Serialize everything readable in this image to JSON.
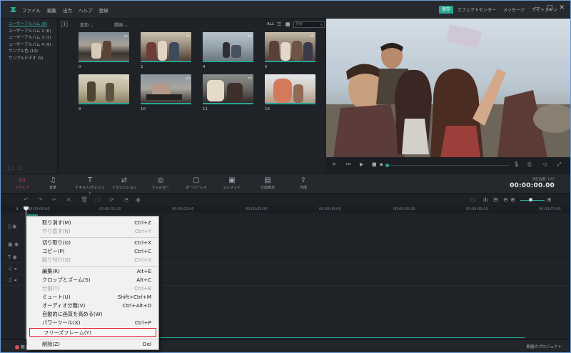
{
  "menubar": [
    "ファイル",
    "編集",
    "出力",
    "ヘルプ",
    "登録"
  ],
  "header": {
    "save": "保存",
    "right_menu": [
      "エフェクトセンター",
      "メッセージ",
      "ライトスキン"
    ],
    "window_controls": [
      "—",
      "□",
      "✕"
    ]
  },
  "sidebar": {
    "items": [
      "ユーザーアルバム (8)",
      "ユーザーアルバム 2 (6)",
      "ユーザーアルバム 3 (1)",
      "ユーザーアルバム 4 (9)",
      "サンプル色 (13)",
      "サンプルビデオ (9)"
    ]
  },
  "media": {
    "import_label": "追加 ⌄",
    "record_label": "録画 ⌄",
    "all_label": "ALL",
    "search_placeholder": "検索",
    "thumbs": [
      "0",
      "2",
      "4",
      "5",
      "8",
      "10",
      "11",
      "16"
    ]
  },
  "tabs": [
    "メディア",
    "音楽",
    "テキスト/クレジット",
    "トランジション",
    "フィルター",
    "オーバーレイ",
    "エレメント",
    "分割表示",
    "作成"
  ],
  "timecode": {
    "label": "現在位置: 1/47",
    "value": "00:00:00.00"
  },
  "ruler": [
    "00:00:00:00",
    "00:00:01:00",
    "00:00:02:00",
    "00:00:03:00",
    "00:00:04:00",
    "00:00:05:00",
    "00:00:06:00",
    "00:00:07:00"
  ],
  "context_menu": [
    {
      "label": "取り消す(M)",
      "shortcut": "Ctrl+Z",
      "disabled": false
    },
    {
      "label": "やり直す(N)",
      "shortcut": "Ctrl+Y",
      "disabled": true
    },
    {
      "label": "切り取り(O)",
      "shortcut": "Ctrl+X",
      "disabled": false
    },
    {
      "label": "コピー(P)",
      "shortcut": "Ctrl+C",
      "disabled": false
    },
    {
      "label": "貼り付け(Q)",
      "shortcut": "Ctrl+V",
      "disabled": true
    },
    {
      "label": "編集(R)",
      "shortcut": "Alt+E",
      "disabled": false
    },
    {
      "label": "クロップとズーム(S)",
      "shortcut": "Alt+C",
      "disabled": false
    },
    {
      "label": "分割(T)",
      "shortcut": "Ctrl+B",
      "disabled": true
    },
    {
      "label": "ミュート(U)",
      "shortcut": "Shift+Ctrl+M",
      "disabled": false
    },
    {
      "label": "オーディオ分離(V)",
      "shortcut": "Ctrl+Alt+D",
      "disabled": false
    },
    {
      "label": "自動的に画質を高める(W)",
      "shortcut": "",
      "disabled": false
    },
    {
      "label": "パワーツール(X)",
      "shortcut": "Ctrl+P",
      "disabled": false
    },
    {
      "label": "フリーズフレーム(Y)",
      "shortcut": "",
      "disabled": false
    },
    {
      "label": "削除(Z)",
      "shortcut": "Del",
      "disabled": false
    }
  ],
  "footer": {
    "new_track": "新し",
    "project_name": "無題のプロジェクト"
  },
  "colors": {
    "accent": "#2aa493",
    "active_tab": "#d94e4e",
    "highlight_border": "#e0242b"
  }
}
